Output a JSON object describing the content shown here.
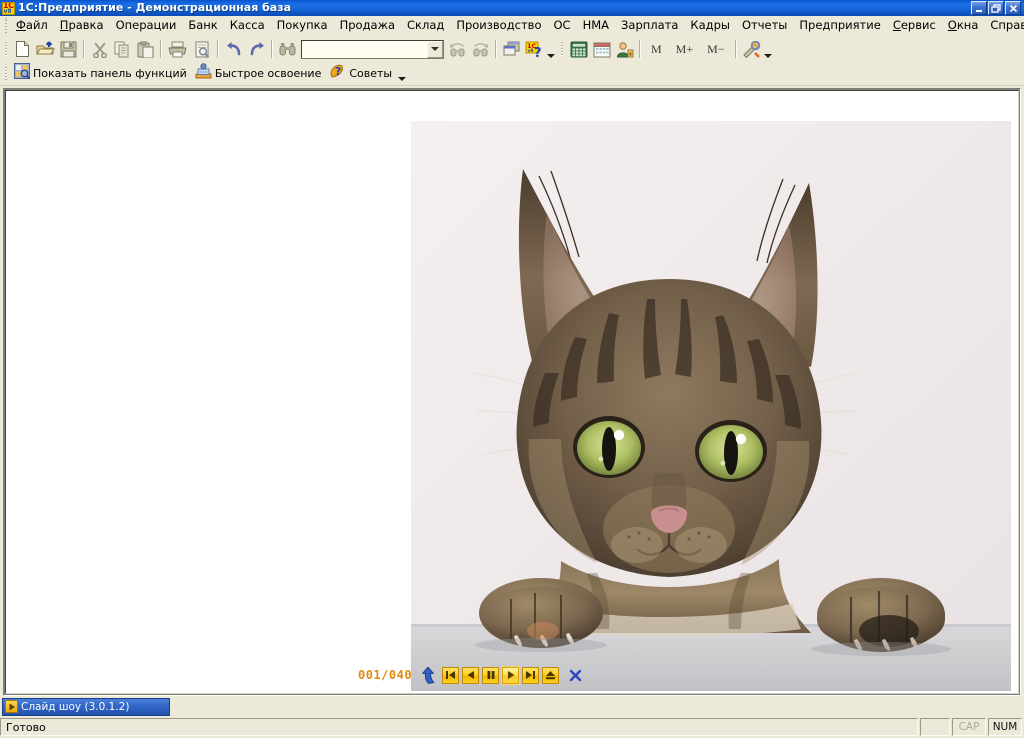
{
  "window": {
    "title": "1С:Предприятие - Демонстрационная база",
    "app_icon": "1c-v8-logo-icon",
    "icon_text_top": "1C",
    "icon_text_bottom": "v8",
    "controls": [
      {
        "name": "minimize-button",
        "glyph": "minimize-icon"
      },
      {
        "name": "restore-button",
        "glyph": "restore-icon"
      },
      {
        "name": "close-button",
        "glyph": "close-icon"
      }
    ]
  },
  "menubar": {
    "items": [
      {
        "label": "Файл",
        "accel": "Ф"
      },
      {
        "label": "Правка",
        "accel": "П"
      },
      {
        "label": "Операции",
        "accel": ""
      },
      {
        "label": "Банк",
        "accel": ""
      },
      {
        "label": "Касса",
        "accel": ""
      },
      {
        "label": "Покупка",
        "accel": ""
      },
      {
        "label": "Продажа",
        "accel": ""
      },
      {
        "label": "Склад",
        "accel": ""
      },
      {
        "label": "Производство",
        "accel": ""
      },
      {
        "label": "ОС",
        "accel": ""
      },
      {
        "label": "НМА",
        "accel": ""
      },
      {
        "label": "Зарплата",
        "accel": ""
      },
      {
        "label": "Кадры",
        "accel": ""
      },
      {
        "label": "Отчеты",
        "accel": ""
      },
      {
        "label": "Предприятие",
        "accel": ""
      },
      {
        "label": "Сервис",
        "accel": "С"
      },
      {
        "label": "Окна",
        "accel": "О"
      },
      {
        "label": "Справка",
        "accel": ""
      }
    ]
  },
  "toolbar": {
    "buttons": [
      {
        "name": "new-document-button",
        "icon": "new-document-icon"
      },
      {
        "name": "open-file-button",
        "icon": "open-folder-icon"
      },
      {
        "name": "save-button",
        "icon": "floppy-save-icon"
      },
      {
        "name": "cut-button",
        "icon": "scissors-icon"
      },
      {
        "name": "copy-button",
        "icon": "copy-icon"
      },
      {
        "name": "paste-button",
        "icon": "clipboard-paste-icon"
      },
      {
        "name": "print-button",
        "icon": "printer-icon"
      },
      {
        "name": "print-preview-button",
        "icon": "print-preview-icon"
      },
      {
        "name": "undo-button",
        "icon": "undo-arrow-icon"
      },
      {
        "name": "redo-button",
        "icon": "redo-arrow-icon"
      },
      {
        "name": "find-button",
        "icon": "binoculars-icon"
      }
    ],
    "search": {
      "value": "",
      "placeholder": ""
    },
    "buttons_right": [
      {
        "name": "find-previous-button",
        "icon": "binoculars-prev-icon"
      },
      {
        "name": "find-next-button",
        "icon": "binoculars-next-icon"
      },
      {
        "name": "window-list-button",
        "icon": "windows-cascade-icon"
      },
      {
        "name": "help-button",
        "icon": "1c-help-icon"
      },
      {
        "name": "calculator-button",
        "icon": "calculator-icon"
      },
      {
        "name": "calendar-button",
        "icon": "calendar-icon"
      },
      {
        "name": "user-button",
        "icon": "person-icon"
      }
    ],
    "memory": [
      {
        "name": "memory-recall-button",
        "label": "M"
      },
      {
        "name": "memory-add-button",
        "label": "M+"
      },
      {
        "name": "memory-subtract-button",
        "label": "M−"
      }
    ],
    "settings": {
      "name": "settings-tools-button",
      "icon": "hammer-wrench-icon"
    },
    "overflow_caret": "chevron-down-icon"
  },
  "toolbar2": {
    "items": [
      {
        "name": "show-functions-panel-button",
        "label": "Показать панель функций",
        "icon": "functions-panel-icon"
      },
      {
        "name": "quick-start-button",
        "label": "Быстрое освоение",
        "icon": "quick-start-icon"
      },
      {
        "name": "tips-button",
        "label": "Советы",
        "icon": "tips-lightbulb-icon"
      }
    ],
    "overflow_caret": "chevron-down-icon"
  },
  "slideshow": {
    "counter": "001/040",
    "current_index": 1,
    "total": 40,
    "background_color": "#ffffff",
    "image": {
      "name": "cat-photo",
      "description": "Tabby cat with green eyes and front paws resting on a ledge"
    },
    "controls": [
      {
        "name": "slideshow-up-button",
        "icon": "up-arrow-icon",
        "active": false,
        "style": "arrow"
      },
      {
        "name": "first-slide-button",
        "icon": "skip-first-icon",
        "active": false,
        "style": "button"
      },
      {
        "name": "previous-slide-button",
        "icon": "previous-icon",
        "active": false,
        "style": "button"
      },
      {
        "name": "pause-button",
        "icon": "pause-icon",
        "active": false,
        "style": "button"
      },
      {
        "name": "play-button",
        "icon": "play-icon",
        "active": true,
        "style": "button"
      },
      {
        "name": "next-slide-button",
        "icon": "skip-next-icon",
        "active": false,
        "style": "button"
      },
      {
        "name": "eject-button",
        "icon": "eject-icon",
        "active": false,
        "style": "button"
      },
      {
        "name": "close-slideshow-button",
        "icon": "close-x-icon",
        "active": false,
        "style": "x"
      }
    ],
    "accent_color": "#ffd21f",
    "counter_color": "#e08a10"
  },
  "taskbar": {
    "buttons": [
      {
        "name": "taskbar-item-slideshow",
        "label": "Слайд шоу (3.0.1.2)",
        "icon": "play-icon",
        "active": true
      }
    ]
  },
  "statusbar": {
    "message": "Готово",
    "indicators": [
      {
        "name": "status-caps-lock",
        "label": "CAP",
        "active": false
      },
      {
        "name": "status-num-lock",
        "label": "NUM",
        "active": true
      }
    ]
  }
}
